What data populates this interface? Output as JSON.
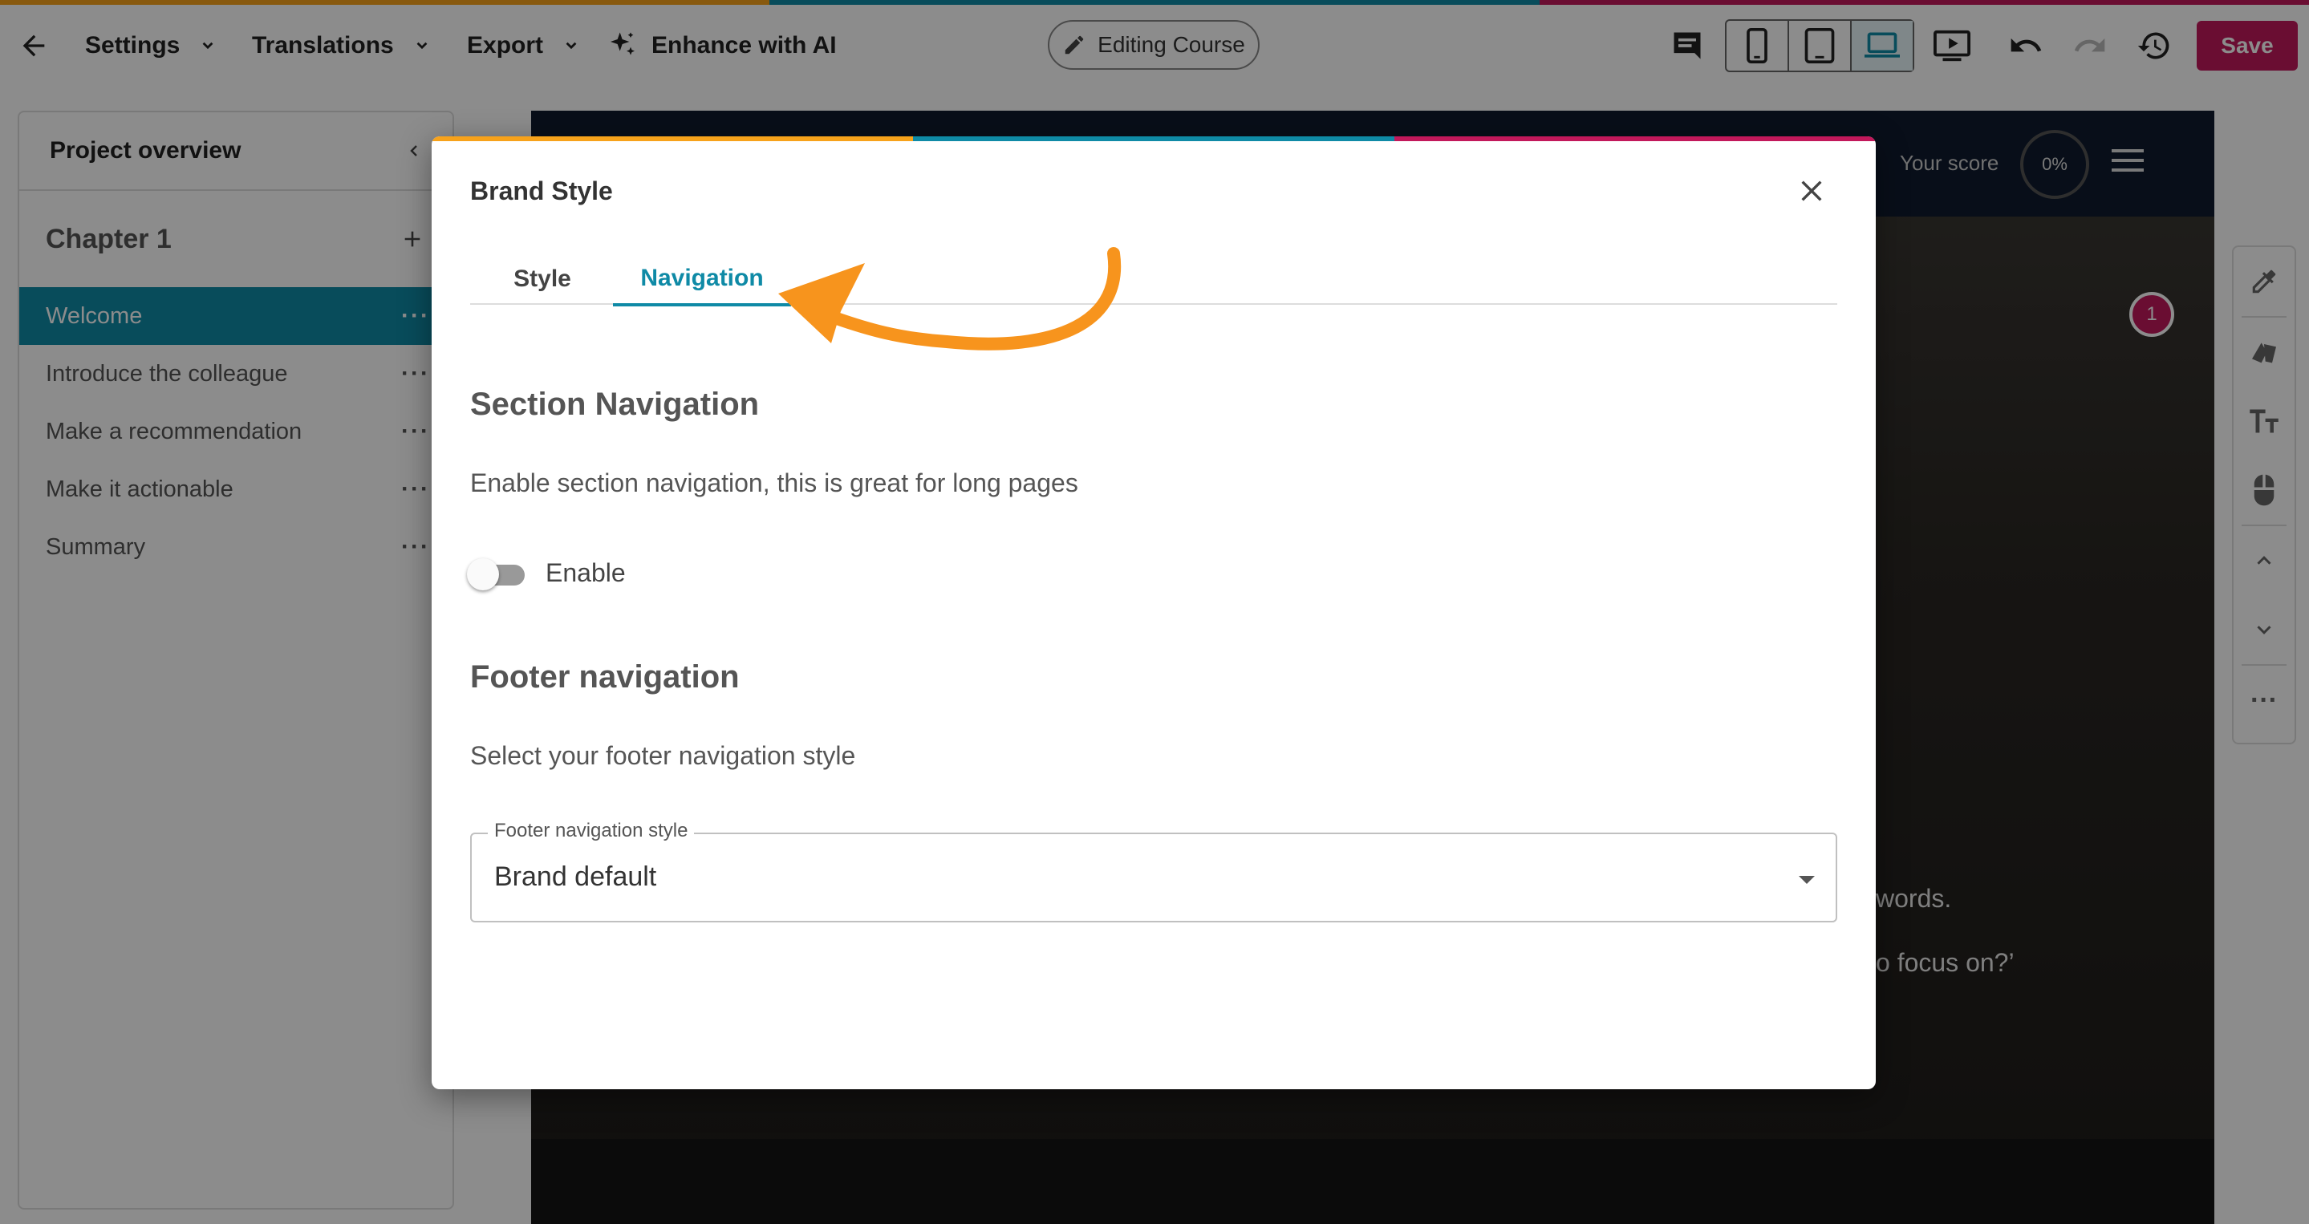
{
  "colors": {
    "brand_orange": "#f7a21b",
    "brand_teal": "#0f8aa6",
    "brand_pink": "#c2185b",
    "arrow_orange": "#f7941d"
  },
  "toolbar": {
    "settings_label": "Settings",
    "translations_label": "Translations",
    "export_label": "Export",
    "enhance_label": "Enhance with AI",
    "editing_label": "Editing Course",
    "save_label": "Save"
  },
  "sidebar": {
    "title": "Project overview",
    "chapter": "Chapter 1",
    "items": [
      {
        "label": "Welcome"
      },
      {
        "label": "Introduce the colleague"
      },
      {
        "label": "Make a recommendation"
      },
      {
        "label": "Make it actionable"
      },
      {
        "label": "Summary"
      }
    ]
  },
  "preview": {
    "score_label": "Your score",
    "score_value": "0%",
    "badge": "1",
    "text_words": "words.",
    "text_focus": "o focus on?’"
  },
  "modal": {
    "title": "Brand Style",
    "tabs": [
      {
        "label": "Style"
      },
      {
        "label": "Navigation"
      }
    ],
    "active_tab": "Navigation",
    "section_nav": {
      "heading": "Section Navigation",
      "description": "Enable section navigation, this is great for long pages",
      "toggle_label": "Enable",
      "enabled": false
    },
    "footer_nav": {
      "heading": "Footer navigation",
      "description": "Select your footer navigation style",
      "select_label": "Footer navigation style",
      "select_value": "Brand default"
    }
  }
}
